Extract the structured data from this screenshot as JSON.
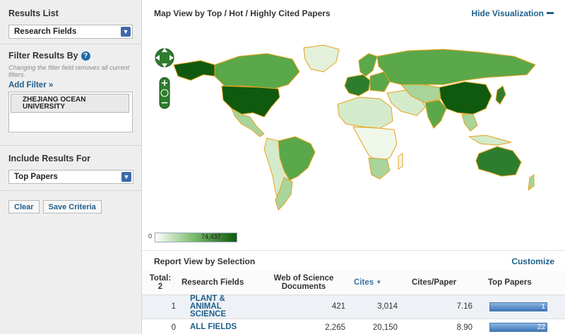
{
  "sidebar": {
    "results_list_label": "Results List",
    "results_list_value": "Research Fields",
    "filter_heading": "Filter Results By",
    "filter_note": "Changing the filter field removes all current filters.",
    "add_filter": "Add Filter »",
    "filters": [
      "ZHEJIANG OCEAN UNIVERSITY"
    ],
    "include_label": "Include Results For",
    "include_value": "Top Papers",
    "clear_button": "Clear",
    "save_button": "Save Criteria"
  },
  "map": {
    "title": "Map View by Top / Hot / Highly Cited Papers",
    "hide_label": "Hide Visualization",
    "legend_min": "0",
    "legend_max": "74,437"
  },
  "report": {
    "title": "Report View by Selection",
    "customize": "Customize",
    "columns": {
      "total": "Total:",
      "total_count": "2",
      "field": "Research Fields",
      "wos": "Web of Science Documents",
      "cites": "Cites",
      "cites_per_paper": "Cites/Paper",
      "top_papers": "Top Papers"
    },
    "rows": [
      {
        "index": "1",
        "field": "PLANT & ANIMAL SCIENCE",
        "wos": "421",
        "cites": "3,014",
        "cpp": "7.16",
        "top": "1",
        "top_fraction": 0.05
      },
      {
        "index": "0",
        "field": "ALL FIELDS",
        "wos": "2,265",
        "cites": "20,150",
        "cpp": "8.90",
        "top": "22",
        "top_fraction": 1.0
      }
    ]
  },
  "colors": {
    "accent": "#1f5f8b",
    "map_dark": "#0f5a0f",
    "map_mid": "#5aa84a",
    "map_light": "#e3f1dc",
    "border": "#e6a21a"
  }
}
